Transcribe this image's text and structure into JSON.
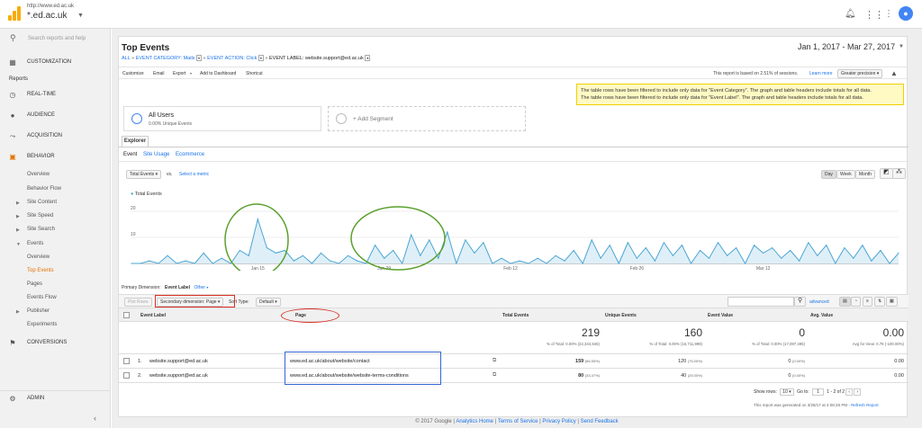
{
  "topbar": {
    "account_url": "http://www.ed.ac.uk",
    "account_name": "*.ed.ac.uk"
  },
  "sidebar": {
    "search_placeholder": "Search reports and help",
    "customization": "CUSTOMIZATION",
    "reports_label": "Reports",
    "realtime": "REAL-TIME",
    "audience": "AUDIENCE",
    "acquisition": "ACQUISITION",
    "behavior": "BEHAVIOR",
    "overview": "Overview",
    "behavior_flow": "Behavior Flow",
    "site_content": "Site Content",
    "site_speed": "Site Speed",
    "site_search": "Site Search",
    "events": "Events",
    "events_overview": "Overview",
    "top_events": "Top Events",
    "pages": "Pages",
    "events_flow": "Events Flow",
    "publisher": "Publisher",
    "experiments": "Experiments",
    "conversions": "CONVERSIONS",
    "admin": "ADMIN"
  },
  "header": {
    "title": "Top Events",
    "date_range": "Jan 1, 2017 - Mar 27, 2017",
    "breadcrumb": {
      "all": "ALL",
      "cat": "EVENT CATEGORY: Mails",
      "action": "EVENT ACTION: Click",
      "label": "EVENT LABEL: website.support@ed.ac.uk"
    }
  },
  "toolbar": {
    "customize": "Customize",
    "email": "Email",
    "export": "Export",
    "add_dashboard": "Add to Dashboard",
    "shortcut": "Shortcut",
    "sessions_text": "This report is based on 2.51% of sessions.",
    "learn_more": "Learn more",
    "precision": "Greater precision"
  },
  "notice": {
    "line1": "The table rows have been filtered to include only data for \"Event Category\". The graph and table headers include totals for all data.",
    "line2": "The table rows have been filtered to include only data for \"Event Label\". The graph and table headers include totals for all data."
  },
  "segments": {
    "all_users": "All Users",
    "all_users_sub": "0.00% Unique Events",
    "add_segment": "+ Add Segment"
  },
  "explorer": {
    "tab": "Explorer",
    "sub_event": "Event",
    "sub_site_usage": "Site Usage",
    "sub_ecommerce": "Ecommerce",
    "metric": "Total Events",
    "vs": "vs.",
    "select_metric": "Select a metric",
    "day": "Day",
    "week": "Week",
    "month": "Month"
  },
  "chart_data": {
    "type": "line",
    "legend": "Total Events",
    "ylim": [
      0,
      20
    ],
    "yticks": [
      "20",
      "10"
    ],
    "xticklabels": [
      "Jan 15",
      "Jan 29",
      "Feb 12",
      "Feb 26",
      "Mar 12"
    ],
    "x": [
      "Jan 1",
      "Jan 2",
      "Jan 3",
      "Jan 4",
      "Jan 5",
      "Jan 6",
      "Jan 7",
      "Jan 8",
      "Jan 9",
      "Jan 10",
      "Jan 11",
      "Jan 12",
      "Jan 13",
      "Jan 14",
      "Jan 15",
      "Jan 16",
      "Jan 17",
      "Jan 18",
      "Jan 19",
      "Jan 20",
      "Jan 21",
      "Jan 22",
      "Jan 23",
      "Jan 24",
      "Jan 25",
      "Jan 26",
      "Jan 27",
      "Jan 28",
      "Jan 29",
      "Jan 30",
      "Jan 31",
      "Feb 1",
      "Feb 2",
      "Feb 3",
      "Feb 4",
      "Feb 5",
      "Feb 6",
      "Feb 7",
      "Feb 8",
      "Feb 9",
      "Feb 10",
      "Feb 11",
      "Feb 12",
      "Feb 13",
      "Feb 14",
      "Feb 15",
      "Feb 16",
      "Feb 17",
      "Feb 18",
      "Feb 19",
      "Feb 20",
      "Feb 21",
      "Feb 22",
      "Feb 23",
      "Feb 24",
      "Feb 25",
      "Feb 26",
      "Feb 27",
      "Feb 28",
      "Mar 1",
      "Mar 2",
      "Mar 3",
      "Mar 4",
      "Mar 5",
      "Mar 6",
      "Mar 7",
      "Mar 8",
      "Mar 9",
      "Mar 10",
      "Mar 11",
      "Mar 12",
      "Mar 13",
      "Mar 14",
      "Mar 15",
      "Mar 16",
      "Mar 17",
      "Mar 18",
      "Mar 19",
      "Mar 20",
      "Mar 21",
      "Mar 22",
      "Mar 23",
      "Mar 24",
      "Mar 25",
      "Mar 26",
      "Mar 27"
    ],
    "values": [
      0,
      0,
      1,
      0,
      3,
      0,
      1,
      0,
      4,
      0,
      2,
      0,
      5,
      3,
      17,
      6,
      4,
      5,
      1,
      3,
      0,
      4,
      1,
      0,
      3,
      1,
      0,
      7,
      2,
      5,
      0,
      11,
      3,
      9,
      2,
      12,
      0,
      9,
      4,
      8,
      0,
      2,
      0,
      1,
      0,
      2,
      0,
      3,
      1,
      5,
      0,
      9,
      2,
      7,
      0,
      8,
      2,
      6,
      1,
      8,
      3,
      7,
      0,
      5,
      2,
      8,
      3,
      6,
      0,
      7,
      4,
      6,
      2,
      5,
      1,
      8,
      3,
      7,
      0,
      6,
      2,
      7,
      1,
      5,
      0,
      4
    ]
  },
  "table_controls": {
    "primary_dim": "Primary Dimension:",
    "event_label": "Event Label",
    "other": "Other",
    "plot_rows": "Plot Rows",
    "secondary_dim": "Secondary dimension: Page",
    "sort_type": "Sort Type:",
    "default": "Default",
    "advanced": "advanced"
  },
  "table": {
    "headers": {
      "event_label": "Event Label",
      "page": "Page",
      "total_events": "Total Events",
      "unique_events": "Unique Events",
      "event_value": "Event Value",
      "avg_value": "Avg. Value"
    },
    "totals": {
      "total": "219",
      "total_sub": "% of Total: 0.00% (22,344,945)",
      "unique": "160",
      "unique_sub": "% of Total: 0.00% (16,711,999)",
      "value": "0",
      "value_sub": "% of Total: 0.00% (17,097,495)",
      "avg": "0.00",
      "avg_sub": "Avg for View: 0.76 (-100.00%)"
    },
    "rows": [
      {
        "idx": "1.",
        "label": "website.support@ed.ac.uk",
        "page": "www.ed.ac.uk/about/website/contact",
        "total": "159",
        "total_pct": "(66.55%)",
        "unique": "120",
        "unique_pct": "(75.00%)",
        "value": "0",
        "value_pct": "(0.00%)",
        "avg": "0.00"
      },
      {
        "idx": "2.",
        "label": "website.support@ed.ac.uk",
        "page": "www.ed.ac.uk/about/website/website-terms-conditions",
        "total": "80",
        "total_pct": "(33.47%)",
        "unique": "40",
        "unique_pct": "(25.00%)",
        "value": "0",
        "value_pct": "(0.00%)",
        "avg": "0.00"
      }
    ]
  },
  "pagination": {
    "show_rows": "Show rows:",
    "rows_val": "10",
    "goto": "Go to:",
    "goto_val": "1",
    "range": "1 - 2 of 2"
  },
  "report_generated": "This report was generated on 3/28/17 at 4:08:28 PM -",
  "refresh": "Refresh Report",
  "footer": {
    "copyright": "© 2017 Google",
    "home": "Analytics Home",
    "terms": "Terms of Service",
    "privacy": "Privacy Policy",
    "feedback": "Send Feedback"
  }
}
